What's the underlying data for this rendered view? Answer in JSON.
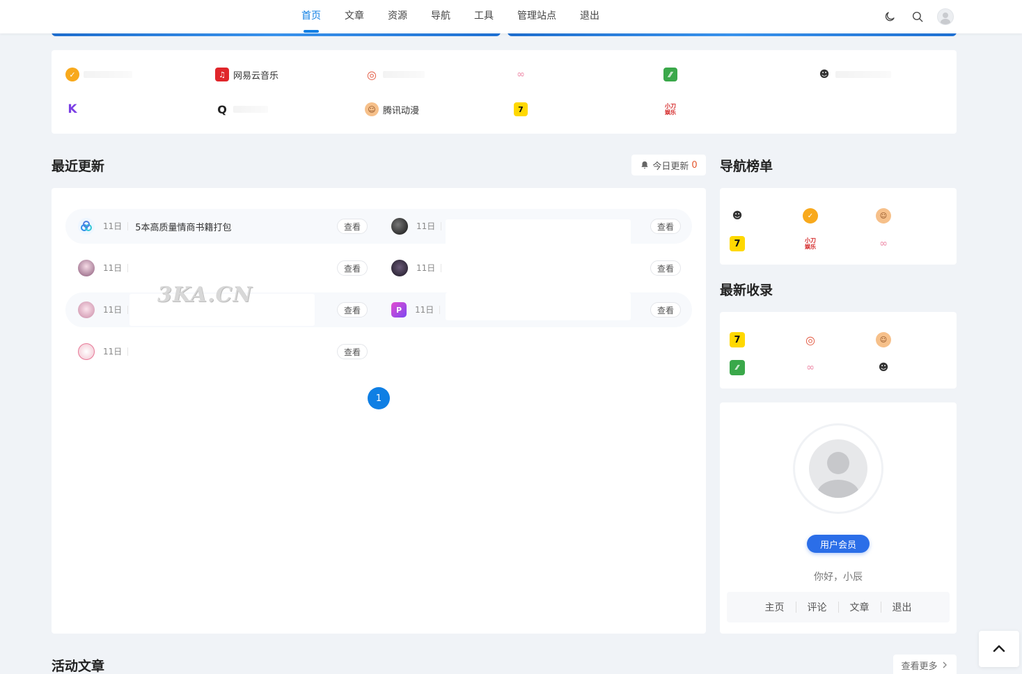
{
  "nav": {
    "items": [
      {
        "label": "首页",
        "active": true
      },
      {
        "label": "文章",
        "active": false
      },
      {
        "label": "资源",
        "active": false
      },
      {
        "label": "导航",
        "active": false
      },
      {
        "label": "工具",
        "active": false
      },
      {
        "label": "管理站点",
        "active": false
      },
      {
        "label": "退出",
        "active": false
      }
    ],
    "icons": [
      "moon-icon",
      "search-icon",
      "user-avatar"
    ]
  },
  "apps": {
    "netease_music": "网易云音乐",
    "tencent_comic": "腾讯动漫"
  },
  "recent": {
    "title": "最近更新",
    "today_label": "今日更新",
    "today_count": "0",
    "date": "11日",
    "first_title": "5本高质量情商书籍打包",
    "view_label": "查看",
    "page": "1"
  },
  "sidebar": {
    "ranking_title": "导航榜单",
    "latest_title": "最新收录"
  },
  "user": {
    "member_label": "用户会员",
    "greeting": "你好，小辰",
    "links": [
      "主页",
      "评论",
      "文章",
      "退出"
    ]
  },
  "articles": {
    "title": "活动文章",
    "more_label": "查看更多"
  },
  "watermark": "3KA.CN",
  "colors": {
    "accent": "#0f7fe4",
    "member": "#2b6ee8",
    "today_count": "#e4572e"
  }
}
